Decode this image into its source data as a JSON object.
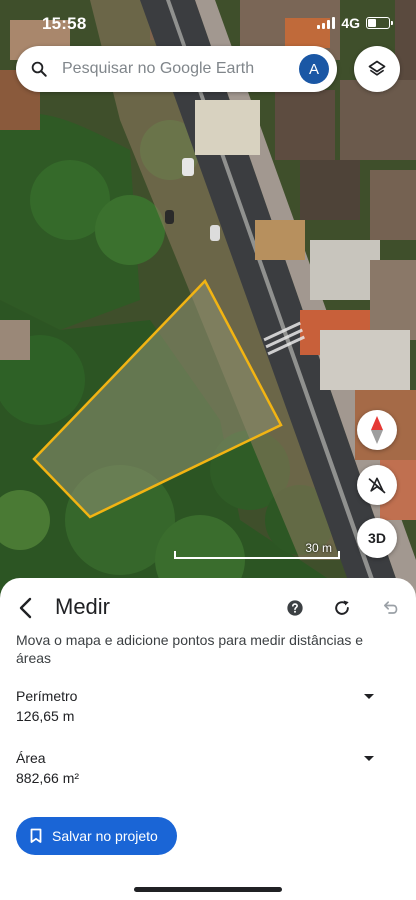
{
  "status_bar": {
    "time": "15:58",
    "network": "4G"
  },
  "search": {
    "placeholder": "Pesquisar no Google Earth",
    "avatar_letter": "A"
  },
  "map": {
    "scale_label": "30 m",
    "button_3d_label": "3D"
  },
  "measure_panel": {
    "title": "Medir",
    "instruction": "Mova o mapa e adicione pontos para medir distâncias e áreas",
    "perimeter": {
      "label": "Perímetro",
      "value": "126,65 m"
    },
    "area": {
      "label": "Área",
      "value": "882,66 m²"
    },
    "save_button_label": "Salvar no projeto"
  },
  "colors": {
    "accent": "#1a65d6",
    "measure_outline": "#f2b413",
    "avatar": "#1a57a5"
  },
  "icons": [
    "search-icon",
    "layers-icon",
    "compass-icon",
    "tilt-icon",
    "back-arrow-icon",
    "help-icon",
    "redo-icon",
    "undo-icon",
    "bookmark-icon"
  ]
}
